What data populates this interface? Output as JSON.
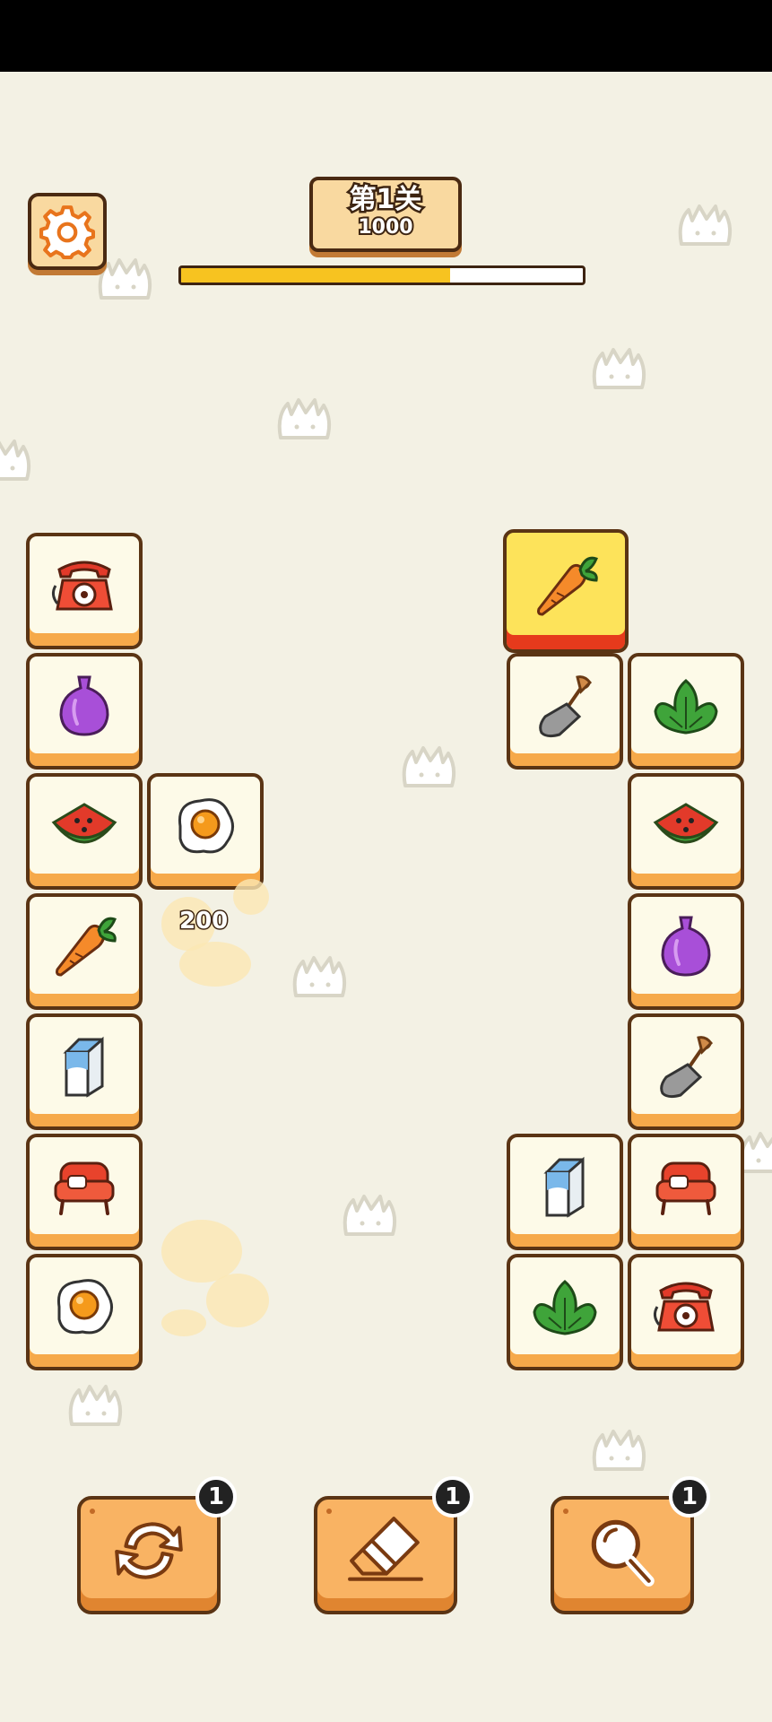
{
  "level": {
    "title": "第1关",
    "score": "1000",
    "progress": 0.67
  },
  "popup_score": "200",
  "left_column": [
    "telephone-icon",
    "onion-icon",
    "watermelon-icon",
    "carrot-icon",
    "milk-carton-icon",
    "armchair-icon",
    "fried-egg-icon"
  ],
  "left_extra": "fried-egg-icon",
  "right_column": [
    "lettuce-icon",
    "watermelon-icon",
    "onion-icon",
    "shovel-icon",
    "armchair-icon",
    "telephone-icon"
  ],
  "right_inner": [
    "carrot-icon",
    "shovel-icon",
    "milk-carton-icon",
    "lettuce-icon"
  ],
  "tools": [
    {
      "name": "shuffle",
      "icon": "refresh-icon",
      "count": "1"
    },
    {
      "name": "eraser",
      "icon": "eraser-icon",
      "count": "1"
    },
    {
      "name": "hint",
      "icon": "magnifier-icon",
      "count": "1"
    }
  ],
  "colors": {
    "background": "#f3f1e4",
    "tile": "#fdfae8",
    "tile_shadow": "#f6a94a",
    "selected": "#fde35a",
    "progress": "#f7c320"
  }
}
